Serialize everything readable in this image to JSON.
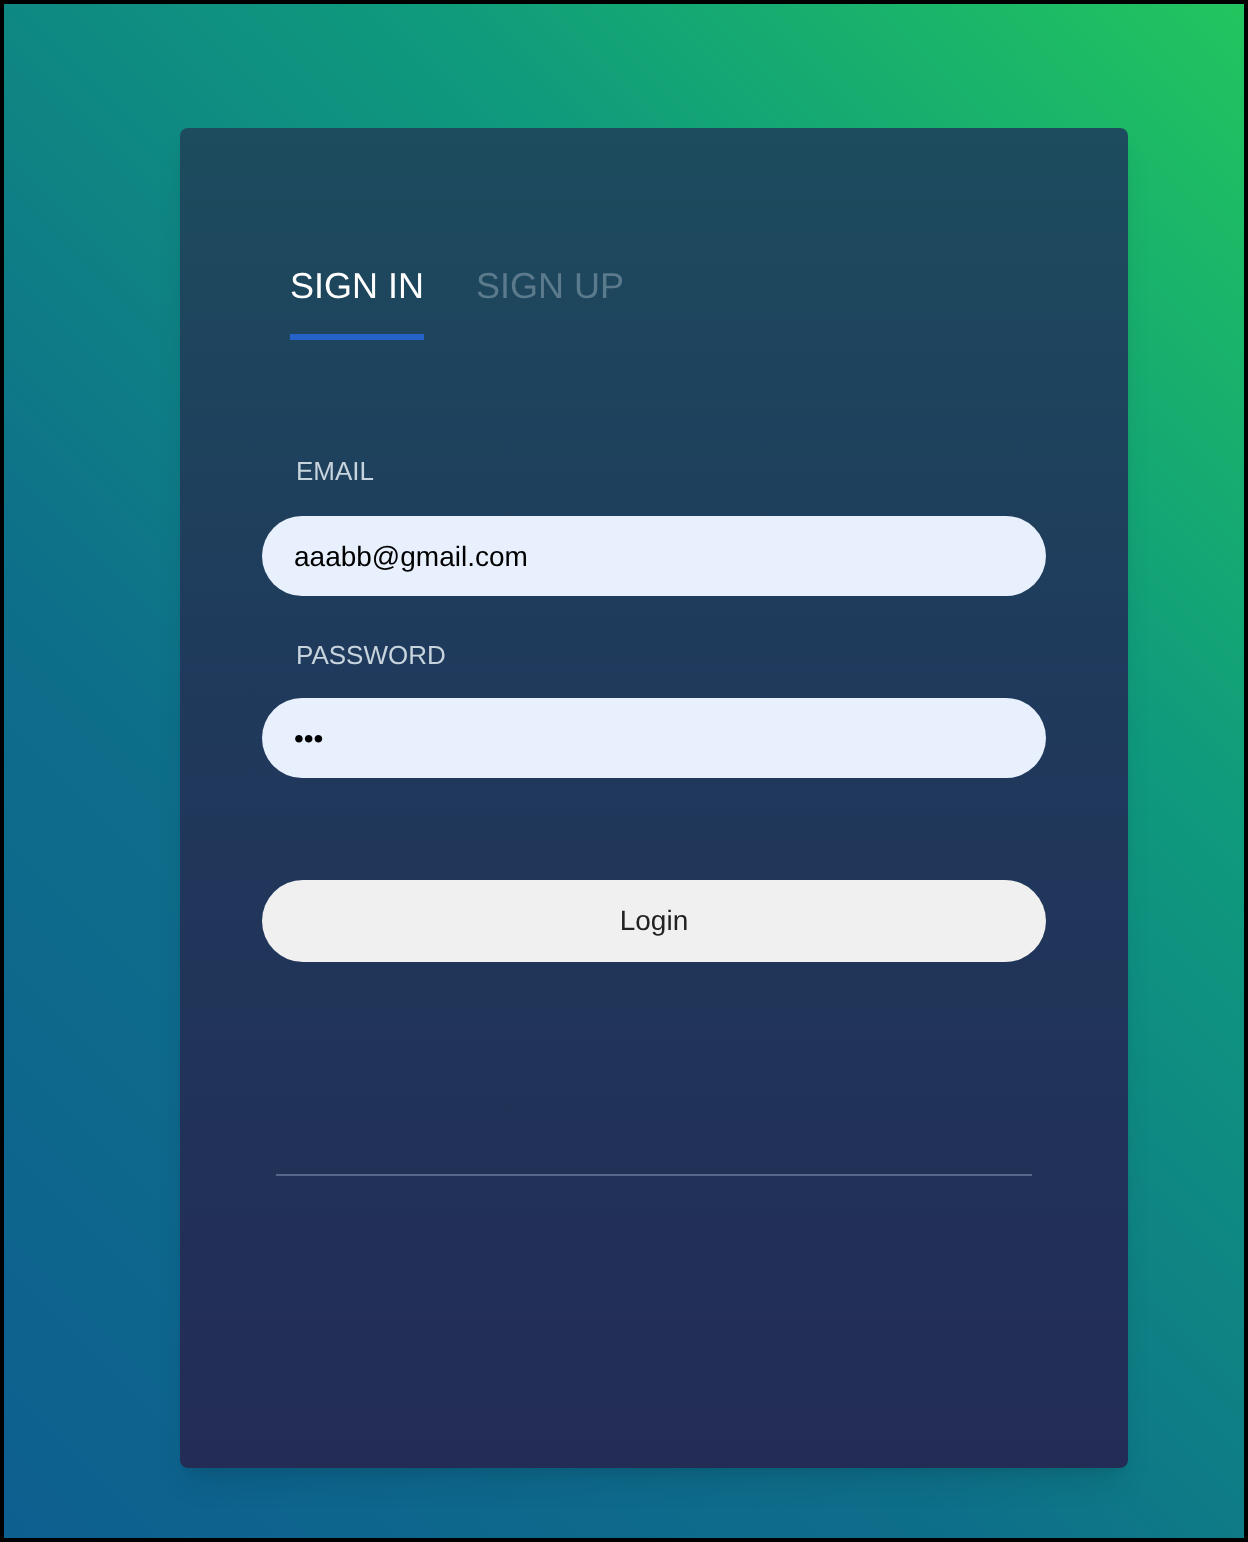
{
  "tabs": [
    {
      "label": "SIGN IN",
      "selected": true
    },
    {
      "label": "SIGN UP",
      "selected": false
    }
  ],
  "fields": [
    {
      "label": "EMAIL",
      "value": "aaabb@gmail.com"
    },
    {
      "label": "PASSWORD",
      "value": "•••"
    }
  ],
  "login_button": "Login"
}
